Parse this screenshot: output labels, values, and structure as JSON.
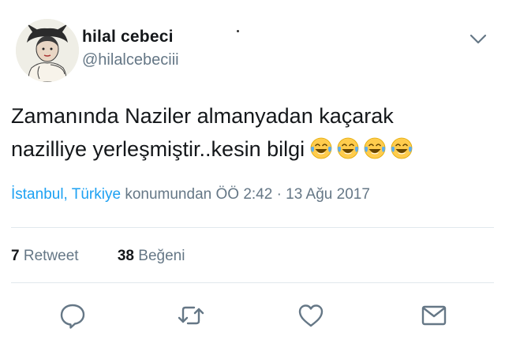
{
  "user": {
    "display_name": "hilal cebeci",
    "handle": "@hilalcebeciii"
  },
  "tweet": {
    "text": "Zamanında Naziler almanyadan kaçarak\nnazilliye yerleşmiştir..kesin bilgi",
    "emojis": [
      "face-with-tears-of-joy",
      "face-with-tears-of-joy",
      "face-with-tears-of-joy",
      "face-with-tears-of-joy"
    ]
  },
  "meta": {
    "location": "İstanbul, Türkiye",
    "location_suffix": " konumundan ÖÖ 2:42 · 13 Ağu 2017"
  },
  "stats": {
    "retweets_count": "7",
    "retweets_label": "Retweet",
    "likes_count": "38",
    "likes_label": "Beğeni"
  },
  "actions": [
    "reply-icon",
    "retweet-icon",
    "like-icon",
    "message-icon"
  ],
  "colors": {
    "link": "#1da1f2",
    "secondary_text": "#657786",
    "primary_text": "#14171a",
    "divider": "#e1e8ed",
    "icon": "#657786",
    "emoji_face": "#ffcc4d",
    "emoji_tears": "#5dadec"
  }
}
